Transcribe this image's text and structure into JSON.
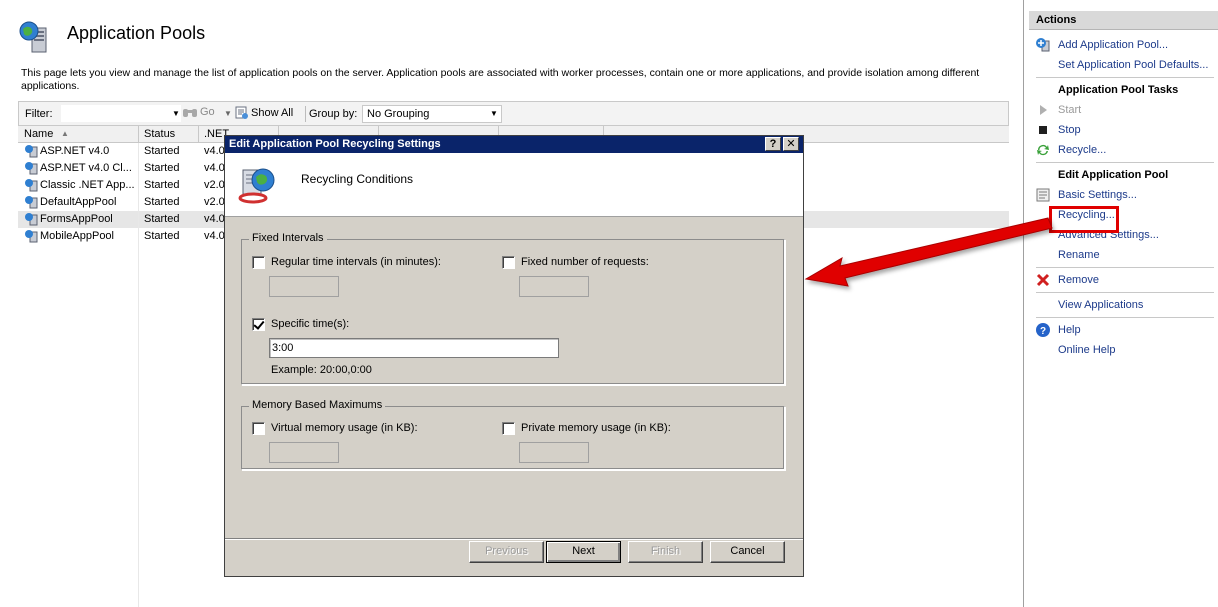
{
  "main": {
    "title": "Application Pools",
    "description": "This page lets you view and manage the list of application pools on the server. Application pools are associated with worker processes, contain one or more applications, and provide isolation among different applications.",
    "filter": {
      "label": "Filter:",
      "value": "",
      "go_label": "Go",
      "show_all_label": "Show All",
      "group_by_label": "Group by:",
      "group_by_value": "No Grouping"
    },
    "grid": {
      "columns": [
        "Name",
        "Status",
        ".NET"
      ],
      "rows": [
        {
          "name": "ASP.NET v4.0",
          "status": "Started",
          "net": "v4.0"
        },
        {
          "name": "ASP.NET v4.0 Cl...",
          "status": "Started",
          "net": "v4.0"
        },
        {
          "name": "Classic .NET App...",
          "status": "Started",
          "net": "v2.0"
        },
        {
          "name": "DefaultAppPool",
          "status": "Started",
          "net": "v2.0"
        },
        {
          "name": "FormsAppPool",
          "status": "Started",
          "net": "v4.0"
        },
        {
          "name": "MobileAppPool",
          "status": "Started",
          "net": "v4.0"
        }
      ],
      "selected_row": 4
    }
  },
  "actions": {
    "title": "Actions",
    "items_top": [
      "Add Application Pool...",
      "Set Application Pool Defaults..."
    ],
    "tasks_heading": "Application Pool Tasks",
    "tasks": [
      "Start",
      "Stop",
      "Recycle..."
    ],
    "edit_heading": "Edit Application Pool",
    "edit_items": [
      "Basic Settings...",
      "Recycling...",
      "Advanced Settings...",
      "Rename"
    ],
    "remove": "Remove",
    "view_apps": "View Applications",
    "help": "Help",
    "online_help": "Online Help"
  },
  "dialog": {
    "title": "Edit Application Pool Recycling Settings",
    "help_btn": "?",
    "close_btn": "✕",
    "header": "Recycling Conditions",
    "fixed_intervals": {
      "title": "Fixed Intervals",
      "regular_label": "Regular time intervals (in minutes):",
      "regular_checked": false,
      "regular_value": "",
      "requests_label": "Fixed number of requests:",
      "requests_checked": false,
      "requests_value": "",
      "specific_label": "Specific time(s):",
      "specific_checked": true,
      "specific_value": "3:00",
      "example": "Example: 20:00,0:00"
    },
    "memory": {
      "title": "Memory Based Maximums",
      "virtual_label": "Virtual memory usage (in KB):",
      "virtual_checked": false,
      "virtual_value": "",
      "private_label": "Private memory usage (in KB):",
      "private_checked": false,
      "private_value": ""
    },
    "buttons": {
      "previous": "Previous",
      "next": "Next",
      "finish": "Finish",
      "cancel": "Cancel"
    }
  },
  "colors": {
    "title_bar": "#0a246a",
    "dialog_bg": "#d4d0c8",
    "link": "#1c3a8a",
    "annotation": "#e00000"
  }
}
